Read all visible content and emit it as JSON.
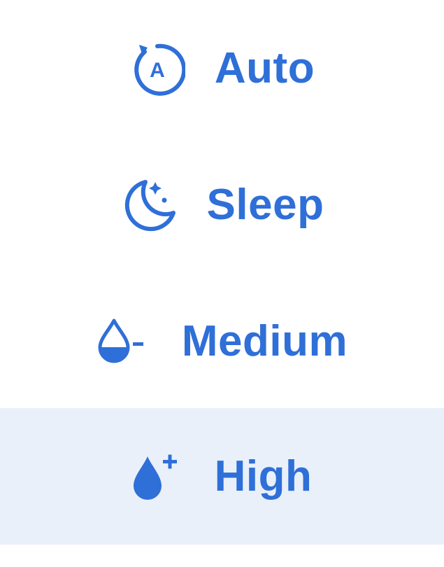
{
  "accent_color": "#2f6fd8",
  "selected_bg_color": "#e9f0fa",
  "items": [
    {
      "label": "Auto",
      "icon": "auto-mode-icon",
      "selected": false
    },
    {
      "label": "Sleep",
      "icon": "sleep-moon-icon",
      "selected": false
    },
    {
      "label": "Medium",
      "icon": "drop-minus-icon",
      "selected": false
    },
    {
      "label": "High",
      "icon": "drop-plus-icon",
      "selected": true
    }
  ]
}
